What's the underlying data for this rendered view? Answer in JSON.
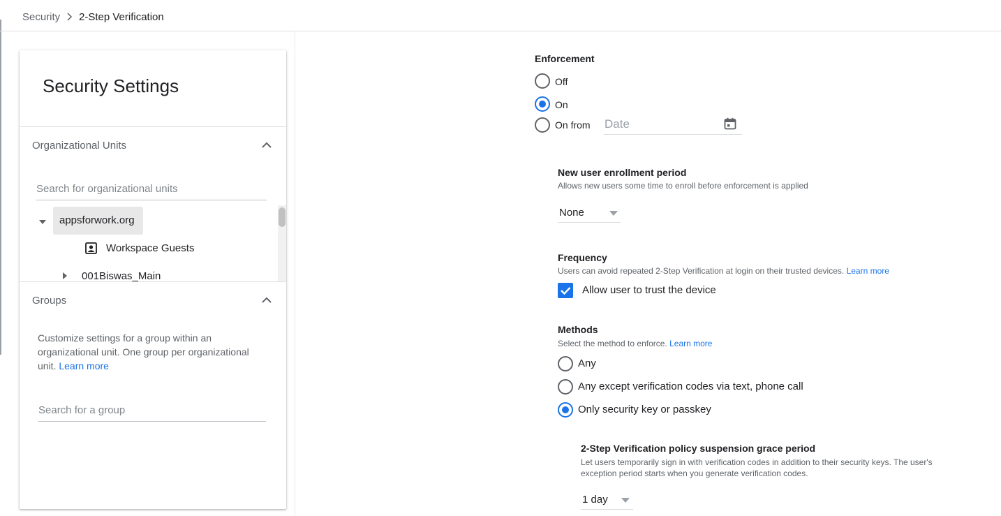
{
  "breadcrumb": {
    "parent": "Security",
    "current": "2-Step Verification"
  },
  "sidebar": {
    "title": "Security Settings",
    "org_units": {
      "heading": "Organizational Units",
      "search_placeholder": "Search for organizational units",
      "tree": [
        {
          "label": "appsforwork.org",
          "expanded": true,
          "selected": true
        },
        {
          "label": "Workspace Guests",
          "icon": "guest-icon"
        },
        {
          "label": "001Biswas_Main",
          "expanded": false
        }
      ]
    },
    "groups": {
      "heading": "Groups",
      "description": "Customize settings for a group within an organizational unit. One group per organizational unit.",
      "learn_more": "Learn more",
      "search_placeholder": "Search for a group"
    }
  },
  "enforcement": {
    "heading": "Enforcement",
    "options": [
      "Off",
      "On",
      "On from"
    ],
    "selected": "On",
    "date_placeholder": "Date"
  },
  "enrollment": {
    "heading": "New user enrollment period",
    "helper": "Allows new users some time to enroll before enforcement is applied",
    "value": "None"
  },
  "frequency": {
    "heading": "Frequency",
    "helper": "Users can avoid repeated 2-Step Verification at login on their trusted devices.",
    "learn_more": "Learn more",
    "checkbox_label": "Allow user to trust the device",
    "checked": true
  },
  "methods": {
    "heading": "Methods",
    "helper": "Select the method to enforce.",
    "learn_more": "Learn more",
    "options": [
      "Any",
      "Any except verification codes via text, phone call",
      "Only security key or passkey"
    ],
    "selected": "Only security key or passkey"
  },
  "grace_period": {
    "heading": "2-Step Verification policy suspension grace period",
    "helper": "Let users temporarily sign in with verification codes in addition to their security keys. The user's exception period starts when you generate verification codes.",
    "value": "1 day"
  },
  "colors": {
    "accent": "#1a73e8",
    "text": "#202124",
    "secondary": "#5f6368"
  }
}
